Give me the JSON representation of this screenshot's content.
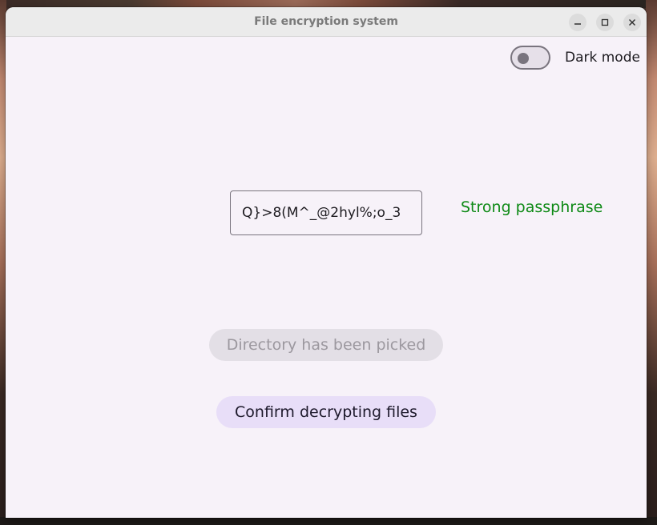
{
  "window": {
    "title": "File encryption system"
  },
  "theme": {
    "dark_mode_label": "Dark mode",
    "dark_mode_on": false
  },
  "passphrase": {
    "value": "Q}>8(M^_@2hyl%;o_3",
    "strength_label": "Strong passphrase",
    "strength_color": "#0e8a16"
  },
  "actions": {
    "pick_directory_label": "Directory has been picked",
    "confirm_label": "Confirm decrypting files"
  },
  "colors": {
    "surface": "#f7f2f9",
    "secondary_container": "#e8def8",
    "outline": "#79747e"
  },
  "icons": {
    "minimize": "minimize-icon",
    "maximize": "maximize-icon",
    "close": "close-icon"
  }
}
